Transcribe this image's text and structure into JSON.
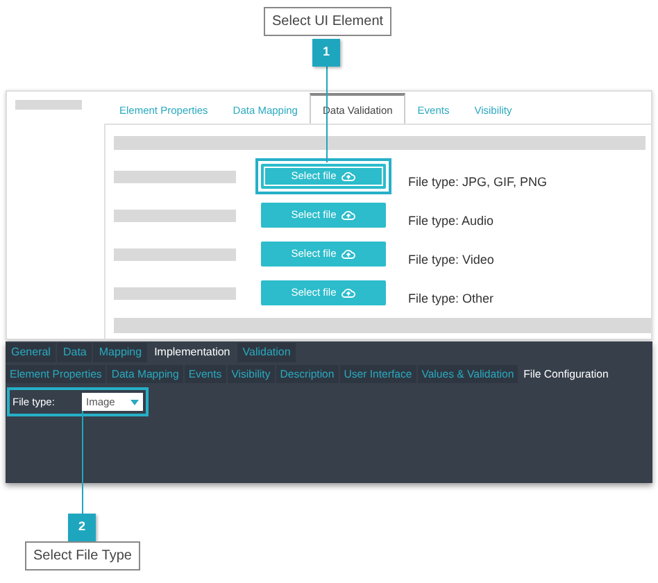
{
  "callouts": [
    {
      "number": "1",
      "label": "Select UI Element"
    },
    {
      "number": "2",
      "label": "Select File Type"
    }
  ],
  "designer": {
    "tabs": [
      {
        "label": "Element Properties",
        "selected": false
      },
      {
        "label": "Data Mapping",
        "selected": false
      },
      {
        "label": "Data Validation",
        "selected": true
      },
      {
        "label": "Events",
        "selected": false
      },
      {
        "label": "Visibility",
        "selected": false
      }
    ],
    "rows": [
      {
        "button": "Select file",
        "file_type": "File type: JPG, GIF, PNG",
        "highlighted": true
      },
      {
        "button": "Select file",
        "file_type": "File type: Audio",
        "highlighted": false
      },
      {
        "button": "Select file",
        "file_type": "File type: Video",
        "highlighted": false
      },
      {
        "button": "Select file",
        "file_type": "File type: Other",
        "highlighted": false
      }
    ]
  },
  "properties": {
    "main_tabs": [
      {
        "label": "General",
        "selected": false
      },
      {
        "label": "Data",
        "selected": false
      },
      {
        "label": "Mapping",
        "selected": false
      },
      {
        "label": "Implementation",
        "selected": true
      },
      {
        "label": "Validation",
        "selected": false
      }
    ],
    "sub_tabs": [
      {
        "label": "Element Properties",
        "selected": false
      },
      {
        "label": "Data Mapping",
        "selected": false
      },
      {
        "label": "Events",
        "selected": false
      },
      {
        "label": "Visibility",
        "selected": false
      },
      {
        "label": "Description",
        "selected": false
      },
      {
        "label": "User Interface",
        "selected": false
      },
      {
        "label": "Values & Validation",
        "selected": false
      },
      {
        "label": "File Configuration",
        "selected": true
      }
    ],
    "field": {
      "label": "File type:",
      "value": "Image",
      "highlighted": true
    }
  }
}
